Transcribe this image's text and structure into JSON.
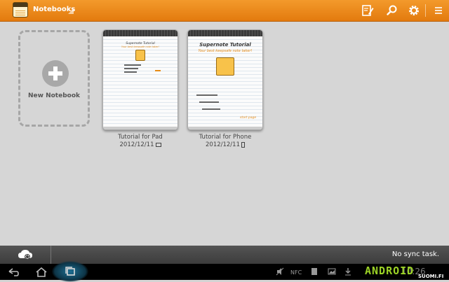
{
  "app": {
    "title": "Notebooks"
  },
  "toolbar": {
    "icons": [
      "edit-page-icon",
      "search-icon",
      "settings-gear-icon",
      "overflow-menu-icon"
    ]
  },
  "new_notebook": {
    "label": "New Notebook"
  },
  "notebooks": [
    {
      "name": "Tutorial for Pad",
      "date": "2012/12/11",
      "device_icon": "tablet-icon",
      "preview_title": "Supernote Tutorial",
      "preview_subtitle": "Your best keepsafe note taker!"
    },
    {
      "name": "Tutorial for Phone",
      "date": "2012/12/11",
      "device_icon": "phone-icon",
      "preview_title": "Supernote Tutorial",
      "preview_subtitle": "Your best keepsafe note taker!",
      "preview_start": "start page"
    }
  ],
  "sync": {
    "status": "No sync task."
  },
  "watermark": {
    "brand": "ANDROID",
    "sub": "SUOMI.FI",
    "clock": "10:26"
  },
  "colors": {
    "accent": "#ec8a1c",
    "background": "#d6d6d6",
    "statusbar": "#474747"
  }
}
